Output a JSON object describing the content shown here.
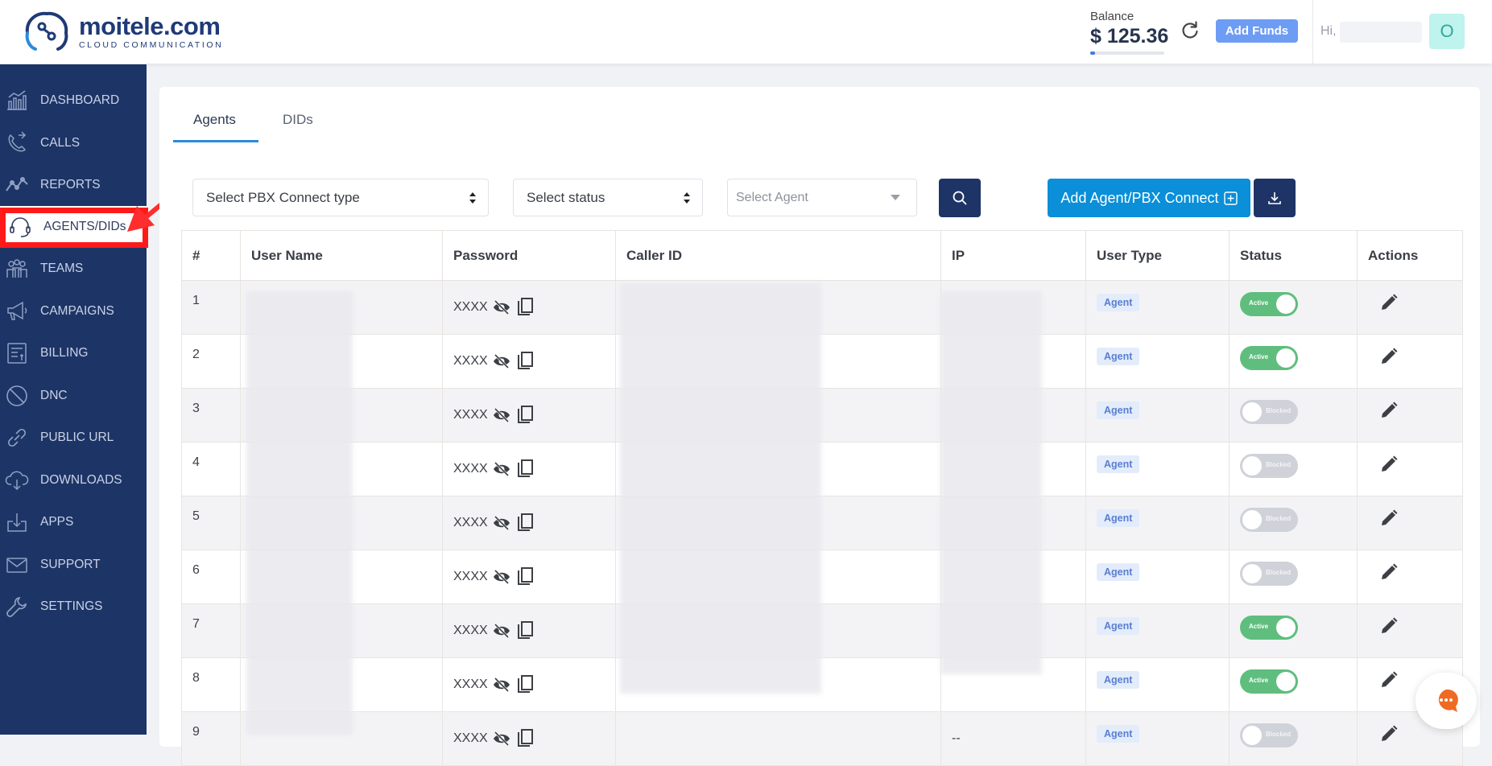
{
  "header": {
    "logo_name": "moitele.com",
    "logo_tagline": "CLOUD COMMUNICATION",
    "balance_label": "Balance",
    "balance_amount": "$ 125.36",
    "add_funds_label": "Add Funds",
    "greeting": "Hi,",
    "avatar_initial": "O"
  },
  "sidebar": {
    "items": [
      {
        "label": "DASHBOARD",
        "icon": "dashboard-chart-icon"
      },
      {
        "label": "CALLS",
        "icon": "phone-icon"
      },
      {
        "label": "REPORTS",
        "icon": "line-chart-icon"
      },
      {
        "label": "AGENTS/DIDs",
        "icon": "headset-icon",
        "active": true
      },
      {
        "label": "TEAMS",
        "icon": "team-icon"
      },
      {
        "label": "CAMPAIGNS",
        "icon": "megaphone-icon"
      },
      {
        "label": "BILLING",
        "icon": "invoice-icon"
      },
      {
        "label": "DNC",
        "icon": "ban-icon"
      },
      {
        "label": "PUBLIC URL",
        "icon": "link-icon"
      },
      {
        "label": "DOWNLOADS",
        "icon": "cloud-download-icon"
      },
      {
        "label": "APPS",
        "icon": "apps-download-icon"
      },
      {
        "label": "SUPPORT",
        "icon": "envelope-icon"
      },
      {
        "label": "SETTINGS",
        "icon": "wrench-icon"
      }
    ]
  },
  "tabs": [
    {
      "label": "Agents",
      "active": true
    },
    {
      "label": "DIDs",
      "active": false
    }
  ],
  "filters": {
    "pbx_type_label": "Select PBX Connect type",
    "status_label": "Select status",
    "agent_placeholder": "Select Agent",
    "add_agent_label": "Add Agent/PBX Connect"
  },
  "table": {
    "columns": [
      "#",
      "User Name",
      "Password",
      "Caller ID",
      "IP",
      "User Type",
      "Status",
      "Actions"
    ],
    "rows": [
      {
        "index": "1",
        "password": "XXXX",
        "user_type": "Agent",
        "status": "Active",
        "ip": ""
      },
      {
        "index": "2",
        "password": "XXXX",
        "user_type": "Agent",
        "status": "Active",
        "ip": ""
      },
      {
        "index": "3",
        "password": "XXXX",
        "user_type": "Agent",
        "status": "Blocked",
        "ip": ""
      },
      {
        "index": "4",
        "password": "XXXX",
        "user_type": "Agent",
        "status": "Blocked",
        "ip": ""
      },
      {
        "index": "5",
        "password": "XXXX",
        "user_type": "Agent",
        "status": "Blocked",
        "ip": ""
      },
      {
        "index": "6",
        "password": "XXXX",
        "user_type": "Agent",
        "status": "Blocked",
        "ip": ""
      },
      {
        "index": "7",
        "password": "XXXX",
        "user_type": "Agent",
        "status": "Active",
        "ip": ""
      },
      {
        "index": "8",
        "password": "XXXX",
        "user_type": "Agent",
        "status": "Active",
        "ip": ""
      },
      {
        "index": "9",
        "password": "XXXX",
        "user_type": "Agent",
        "status": "Blocked",
        "ip": "--"
      }
    ]
  },
  "colors": {
    "sidebar_bg": "#1d3466",
    "primary_button": "#0a8fd8",
    "active_toggle": "#5fbe7e",
    "blocked_toggle": "#cfd2d9",
    "highlight": "#ff1a1a"
  }
}
